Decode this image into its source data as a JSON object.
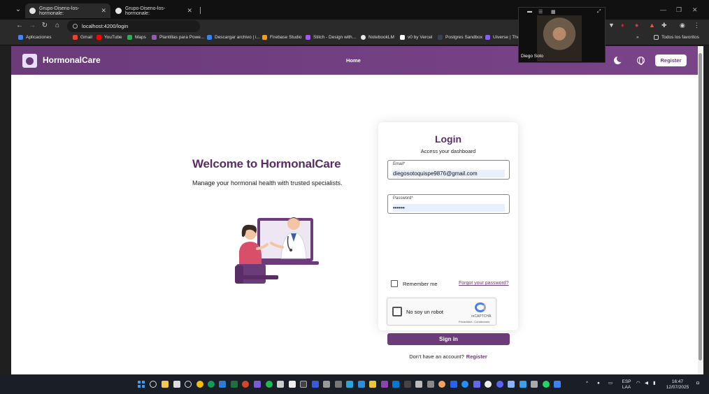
{
  "browser": {
    "tabs": [
      {
        "label": "Grupo-Diseno-los-hormonale:",
        "active": true
      },
      {
        "label": "Grupo-Diseno-los-hormonale:",
        "active": false
      }
    ],
    "url": "localhost:4200/login",
    "bookmarks": [
      {
        "label": "Aplicaciones",
        "color": "#4285f4"
      },
      {
        "label": "Gmail",
        "color": "#ea4335"
      },
      {
        "label": "YouTube",
        "color": "#ff0000"
      },
      {
        "label": "Maps",
        "color": "#34a853"
      },
      {
        "label": "Plantillas para Powe...",
        "color": "#9b59b6"
      },
      {
        "label": "Descargar archivo | i...",
        "color": "#3b82f6"
      },
      {
        "label": "Firebase Studio",
        "color": "#f59e0b"
      },
      {
        "label": "Stitch - Design with...",
        "color": "#a855f7"
      },
      {
        "label": "NotebookLM",
        "color": "#e5e7eb"
      },
      {
        "label": "v0 by Vercel",
        "color": "#ffffff"
      },
      {
        "label": "Postgres Sandbox",
        "color": "#374151"
      },
      {
        "label": "Uiverse | The l",
        "color": "#8b5cf6"
      }
    ],
    "all_bookmarks": "Todos los favoritos"
  },
  "webcam": {
    "name": "Diego Soto"
  },
  "app": {
    "brand": "HormonalCare",
    "nav_home": "Home",
    "register": "Register",
    "accent": "#6b3b7a"
  },
  "hero": {
    "title": "Welcome to HormonalCare",
    "subtitle": "Manage your hormonal health with trusted specialists."
  },
  "login": {
    "title": "Login",
    "subtitle": "Access your dashboard",
    "email_label": "Email*",
    "email_value": "diegosotoquispe9876@gmail.com",
    "password_label": "Password*",
    "password_value": "••••••",
    "remember": "Remember me",
    "forgot": "Forgot your password?",
    "captcha_text": "No soy un robot",
    "captcha_brand": "reCAPTCHA",
    "captcha_links": "Privacidad - Condiciones",
    "signin": "Sign in",
    "no_account": "Don't have an account?",
    "register_link": "Register"
  },
  "taskbar": {
    "lang": "ESP\nLAA",
    "time": "16:47",
    "date": "12/07/2025"
  }
}
